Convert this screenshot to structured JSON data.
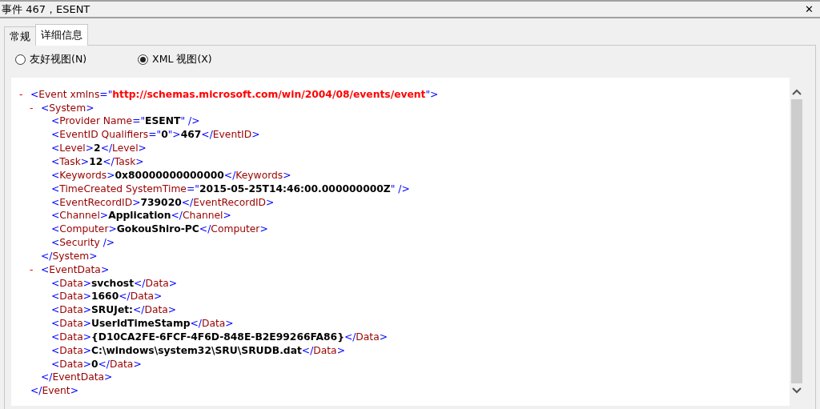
{
  "window": {
    "title": "事件 467，ESENT",
    "close": "✕"
  },
  "tabs": [
    {
      "label": "常规",
      "selected": false
    },
    {
      "label": "详细信息",
      "selected": true
    }
  ],
  "view_options": [
    {
      "label": "友好视图(N)",
      "selected": false
    },
    {
      "label": "XML 视图(X)",
      "selected": true
    }
  ],
  "xml": {
    "toggle": "-",
    "expanded": true,
    "open": [
      {
        "kind": "punct",
        "text": "<"
      },
      {
        "kind": "name",
        "text": "Event xmlns"
      },
      {
        "kind": "punct",
        "text": "=\""
      },
      {
        "kind": "url",
        "text": "http://schemas.microsoft.com/win/2004/08/events/event"
      },
      {
        "kind": "punct",
        "text": "\">"
      }
    ],
    "close": [
      {
        "kind": "punct",
        "text": "</"
      },
      {
        "kind": "name",
        "text": "Event"
      },
      {
        "kind": "punct",
        "text": ">"
      }
    ],
    "children": [
      {
        "toggle": "-",
        "expanded": true,
        "open": [
          {
            "kind": "punct",
            "text": "<"
          },
          {
            "kind": "name",
            "text": "System"
          },
          {
            "kind": "punct",
            "text": ">"
          }
        ],
        "close": [
          {
            "kind": "punct",
            "text": "</"
          },
          {
            "kind": "name",
            "text": "System"
          },
          {
            "kind": "punct",
            "text": ">"
          }
        ],
        "children": [
          {
            "line": [
              {
                "kind": "punct",
                "text": "<"
              },
              {
                "kind": "name",
                "text": "Provider Name"
              },
              {
                "kind": "punct",
                "text": "=\""
              },
              {
                "kind": "value",
                "text": "ESENT"
              },
              {
                "kind": "punct",
                "text": "\" />"
              }
            ]
          },
          {
            "line": [
              {
                "kind": "punct",
                "text": "<"
              },
              {
                "kind": "name",
                "text": "EventID Qualifiers"
              },
              {
                "kind": "punct",
                "text": "=\""
              },
              {
                "kind": "value",
                "text": "0"
              },
              {
                "kind": "punct",
                "text": "\">"
              },
              {
                "kind": "value",
                "text": "467"
              },
              {
                "kind": "punct",
                "text": "</"
              },
              {
                "kind": "name",
                "text": "EventID"
              },
              {
                "kind": "punct",
                "text": ">"
              }
            ]
          },
          {
            "line": [
              {
                "kind": "punct",
                "text": "<"
              },
              {
                "kind": "name",
                "text": "Level"
              },
              {
                "kind": "punct",
                "text": ">"
              },
              {
                "kind": "value",
                "text": "2"
              },
              {
                "kind": "punct",
                "text": "</"
              },
              {
                "kind": "name",
                "text": "Level"
              },
              {
                "kind": "punct",
                "text": ">"
              }
            ]
          },
          {
            "line": [
              {
                "kind": "punct",
                "text": "<"
              },
              {
                "kind": "name",
                "text": "Task"
              },
              {
                "kind": "punct",
                "text": ">"
              },
              {
                "kind": "value",
                "text": "12"
              },
              {
                "kind": "punct",
                "text": "</"
              },
              {
                "kind": "name",
                "text": "Task"
              },
              {
                "kind": "punct",
                "text": ">"
              }
            ]
          },
          {
            "line": [
              {
                "kind": "punct",
                "text": "<"
              },
              {
                "kind": "name",
                "text": "Keywords"
              },
              {
                "kind": "punct",
                "text": ">"
              },
              {
                "kind": "value",
                "text": "0x80000000000000"
              },
              {
                "kind": "punct",
                "text": "</"
              },
              {
                "kind": "name",
                "text": "Keywords"
              },
              {
                "kind": "punct",
                "text": ">"
              }
            ]
          },
          {
            "line": [
              {
                "kind": "punct",
                "text": "<"
              },
              {
                "kind": "name",
                "text": "TimeCreated SystemTime"
              },
              {
                "kind": "punct",
                "text": "=\""
              },
              {
                "kind": "value",
                "text": "2015-05-25T14:46:00.000000000Z"
              },
              {
                "kind": "punct",
                "text": "\" />"
              }
            ]
          },
          {
            "line": [
              {
                "kind": "punct",
                "text": "<"
              },
              {
                "kind": "name",
                "text": "EventRecordID"
              },
              {
                "kind": "punct",
                "text": ">"
              },
              {
                "kind": "value",
                "text": "739020"
              },
              {
                "kind": "punct",
                "text": "</"
              },
              {
                "kind": "name",
                "text": "EventRecordID"
              },
              {
                "kind": "punct",
                "text": ">"
              }
            ]
          },
          {
            "line": [
              {
                "kind": "punct",
                "text": "<"
              },
              {
                "kind": "name",
                "text": "Channel"
              },
              {
                "kind": "punct",
                "text": ">"
              },
              {
                "kind": "value",
                "text": "Application"
              },
              {
                "kind": "punct",
                "text": "</"
              },
              {
                "kind": "name",
                "text": "Channel"
              },
              {
                "kind": "punct",
                "text": ">"
              }
            ]
          },
          {
            "line": [
              {
                "kind": "punct",
                "text": "<"
              },
              {
                "kind": "name",
                "text": "Computer"
              },
              {
                "kind": "punct",
                "text": ">"
              },
              {
                "kind": "value",
                "text": "GokouShiro-PC"
              },
              {
                "kind": "punct",
                "text": "</"
              },
              {
                "kind": "name",
                "text": "Computer"
              },
              {
                "kind": "punct",
                "text": ">"
              }
            ]
          },
          {
            "line": [
              {
                "kind": "punct",
                "text": "<"
              },
              {
                "kind": "name",
                "text": "Security"
              },
              {
                "kind": "punct",
                "text": " />"
              }
            ]
          }
        ]
      },
      {
        "toggle": "-",
        "expanded": true,
        "open": [
          {
            "kind": "punct",
            "text": "<"
          },
          {
            "kind": "name",
            "text": "EventData"
          },
          {
            "kind": "punct",
            "text": ">"
          }
        ],
        "close": [
          {
            "kind": "punct",
            "text": "</"
          },
          {
            "kind": "name",
            "text": "EventData"
          },
          {
            "kind": "punct",
            "text": ">"
          }
        ],
        "children": [
          {
            "line": [
              {
                "kind": "punct",
                "text": "<"
              },
              {
                "kind": "name",
                "text": "Data"
              },
              {
                "kind": "punct",
                "text": ">"
              },
              {
                "kind": "value",
                "text": "svchost"
              },
              {
                "kind": "punct",
                "text": "</"
              },
              {
                "kind": "name",
                "text": "Data"
              },
              {
                "kind": "punct",
                "text": ">"
              }
            ]
          },
          {
            "line": [
              {
                "kind": "punct",
                "text": "<"
              },
              {
                "kind": "name",
                "text": "Data"
              },
              {
                "kind": "punct",
                "text": ">"
              },
              {
                "kind": "value",
                "text": "1660"
              },
              {
                "kind": "punct",
                "text": "</"
              },
              {
                "kind": "name",
                "text": "Data"
              },
              {
                "kind": "punct",
                "text": ">"
              }
            ]
          },
          {
            "line": [
              {
                "kind": "punct",
                "text": "<"
              },
              {
                "kind": "name",
                "text": "Data"
              },
              {
                "kind": "punct",
                "text": ">"
              },
              {
                "kind": "value",
                "text": "SRUJet:"
              },
              {
                "kind": "punct",
                "text": "</"
              },
              {
                "kind": "name",
                "text": "Data"
              },
              {
                "kind": "punct",
                "text": ">"
              }
            ]
          },
          {
            "line": [
              {
                "kind": "punct",
                "text": "<"
              },
              {
                "kind": "name",
                "text": "Data"
              },
              {
                "kind": "punct",
                "text": ">"
              },
              {
                "kind": "value",
                "text": "UserIdTimeStamp"
              },
              {
                "kind": "punct",
                "text": "</"
              },
              {
                "kind": "name",
                "text": "Data"
              },
              {
                "kind": "punct",
                "text": ">"
              }
            ]
          },
          {
            "line": [
              {
                "kind": "punct",
                "text": "<"
              },
              {
                "kind": "name",
                "text": "Data"
              },
              {
                "kind": "punct",
                "text": ">"
              },
              {
                "kind": "value",
                "text": "{D10CA2FE-6FCF-4F6D-848E-B2E99266FA86}"
              },
              {
                "kind": "punct",
                "text": "</"
              },
              {
                "kind": "name",
                "text": "Data"
              },
              {
                "kind": "punct",
                "text": ">"
              }
            ]
          },
          {
            "line": [
              {
                "kind": "punct",
                "text": "<"
              },
              {
                "kind": "name",
                "text": "Data"
              },
              {
                "kind": "punct",
                "text": ">"
              },
              {
                "kind": "value",
                "text": "C:\\windows\\system32\\SRU\\SRUDB.dat"
              },
              {
                "kind": "punct",
                "text": "</"
              },
              {
                "kind": "name",
                "text": "Data"
              },
              {
                "kind": "punct",
                "text": ">"
              }
            ]
          },
          {
            "line": [
              {
                "kind": "punct",
                "text": "<"
              },
              {
                "kind": "name",
                "text": "Data"
              },
              {
                "kind": "punct",
                "text": ">"
              },
              {
                "kind": "value",
                "text": "0"
              },
              {
                "kind": "punct",
                "text": "</"
              },
              {
                "kind": "name",
                "text": "Data"
              },
              {
                "kind": "punct",
                "text": ">"
              }
            ]
          }
        ]
      }
    ]
  }
}
